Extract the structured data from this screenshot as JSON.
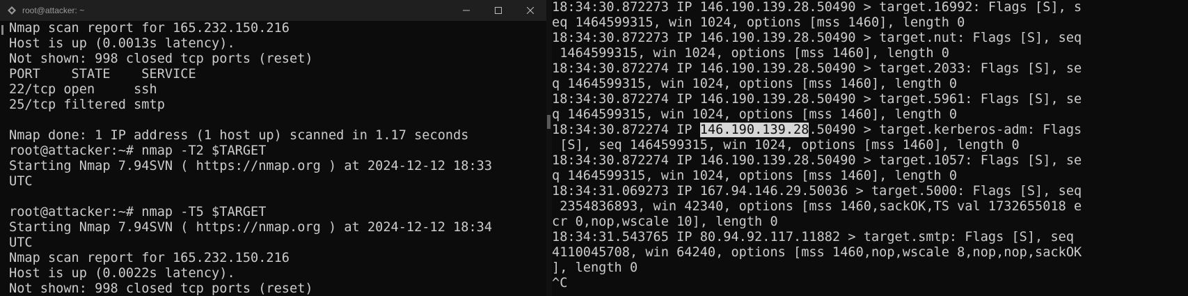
{
  "window": {
    "title": "root@attacker: ~"
  },
  "left_terminal": {
    "lines": [
      "Nmap scan report for 165.232.150.216",
      "Host is up (0.0013s latency).",
      "Not shown: 998 closed tcp ports (reset)",
      "PORT    STATE    SERVICE",
      "22/tcp open     ssh",
      "25/tcp filtered smtp",
      "",
      "Nmap done: 1 IP address (1 host up) scanned in 1.17 seconds",
      "root@attacker:~# nmap -T2 $TARGET",
      "Starting Nmap 7.94SVN ( https://nmap.org ) at 2024-12-12 18:33",
      "UTC",
      "",
      "root@attacker:~# nmap -T5 $TARGET",
      "Starting Nmap 7.94SVN ( https://nmap.org ) at 2024-12-12 18:34",
      "UTC",
      "Nmap scan report for 165.232.150.216",
      "Host is up (0.0022s latency).",
      "Not shown: 998 closed tcp ports (reset)"
    ]
  },
  "right_terminal": {
    "lines": [
      "18:34:30.872273 IP 146.190.139.28.50490 > target.16992: Flags [S], s",
      "eq 1464599315, win 1024, options [mss 1460], length 0",
      "18:34:30.872273 IP 146.190.139.28.50490 > target.nut: Flags [S], seq",
      " 1464599315, win 1024, options [mss 1460], length 0",
      "18:34:30.872274 IP 146.190.139.28.50490 > target.2033: Flags [S], se",
      "q 1464599315, win 1024, options [mss 1460], length 0",
      "18:34:30.872274 IP 146.190.139.28.50490 > target.5961: Flags [S], se",
      "q 1464599315, win 1024, options [mss 1460], length 0",
      "",
      " [S], seq 1464599315, win 1024, options [mss 1460], length 0",
      "18:34:30.872274 IP 146.190.139.28.50490 > target.1057: Flags [S], se",
      "q 1464599315, win 1024, options [mss 1460], length 0",
      "18:34:31.069273 IP 167.94.146.29.50036 > target.5000: Flags [S], seq",
      " 2354836893, win 42340, options [mss 1460,sackOK,TS val 1732655018 e",
      "cr 0,nop,wscale 10], length 0",
      "18:34:31.543765 IP 80.94.92.117.11882 > target.smtp: Flags [S], seq",
      "4110045708, win 64240, options [mss 1460,nop,wscale 8,nop,nop,sackOK",
      "], length 0",
      "^C"
    ],
    "highlight_line": {
      "before": "18:34:30.872274 IP ",
      "selected": "146.190.139.28",
      "after": ".50490 > target.kerberos-adm: Flags"
    }
  }
}
